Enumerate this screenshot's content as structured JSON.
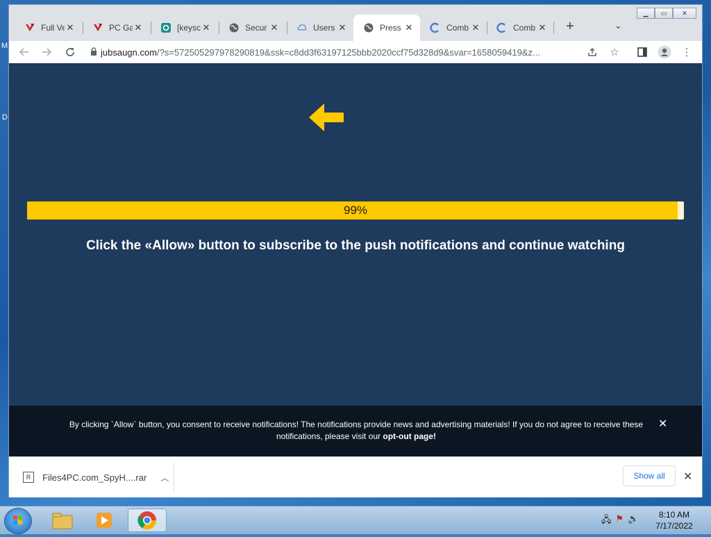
{
  "desktop": {
    "letter_m": "M",
    "letter_d": "D"
  },
  "browser": {
    "tabs": [
      {
        "title": "Full Ve",
        "icon": "red-ribbon-icon"
      },
      {
        "title": "PC Ga",
        "icon": "red-ribbon-icon"
      },
      {
        "title": "[keysc",
        "icon": "teal-gear-icon"
      },
      {
        "title": "Secur",
        "icon": "globe-icon"
      },
      {
        "title": "Users",
        "icon": "cloud-icon"
      },
      {
        "title": "Press",
        "icon": "globe-icon"
      },
      {
        "title": "Comb",
        "icon": "c-logo-icon"
      },
      {
        "title": "Comb",
        "icon": "c-logo-icon"
      }
    ],
    "active_tab": 5,
    "url_domain": "jubsaugn.com",
    "url_rest": "/?s=572505297978290819&ssk=c8dd3f63197125bbb2020ccf75d328d9&svar=1658059419&z..."
  },
  "page": {
    "progress_value": 0.99,
    "progress_label": "99%",
    "headline": "Click the «Allow» button to subscribe to the push notifications and continue watching",
    "consent_text": "By clicking `Allow` button, you consent to receive notifications! The notifications provide news and advertising materials! If you do not agree to receive these notifications, please visit our ",
    "consent_link": "opt-out page!",
    "colors": {
      "background": "#1e3a5c",
      "accent": "#ffc900"
    }
  },
  "downloads": {
    "file_name": "Files4PC.com_SpyH....rar",
    "show_all_label": "Show all"
  },
  "taskbar": {
    "time": "8:10 AM",
    "date": "7/17/2022"
  }
}
